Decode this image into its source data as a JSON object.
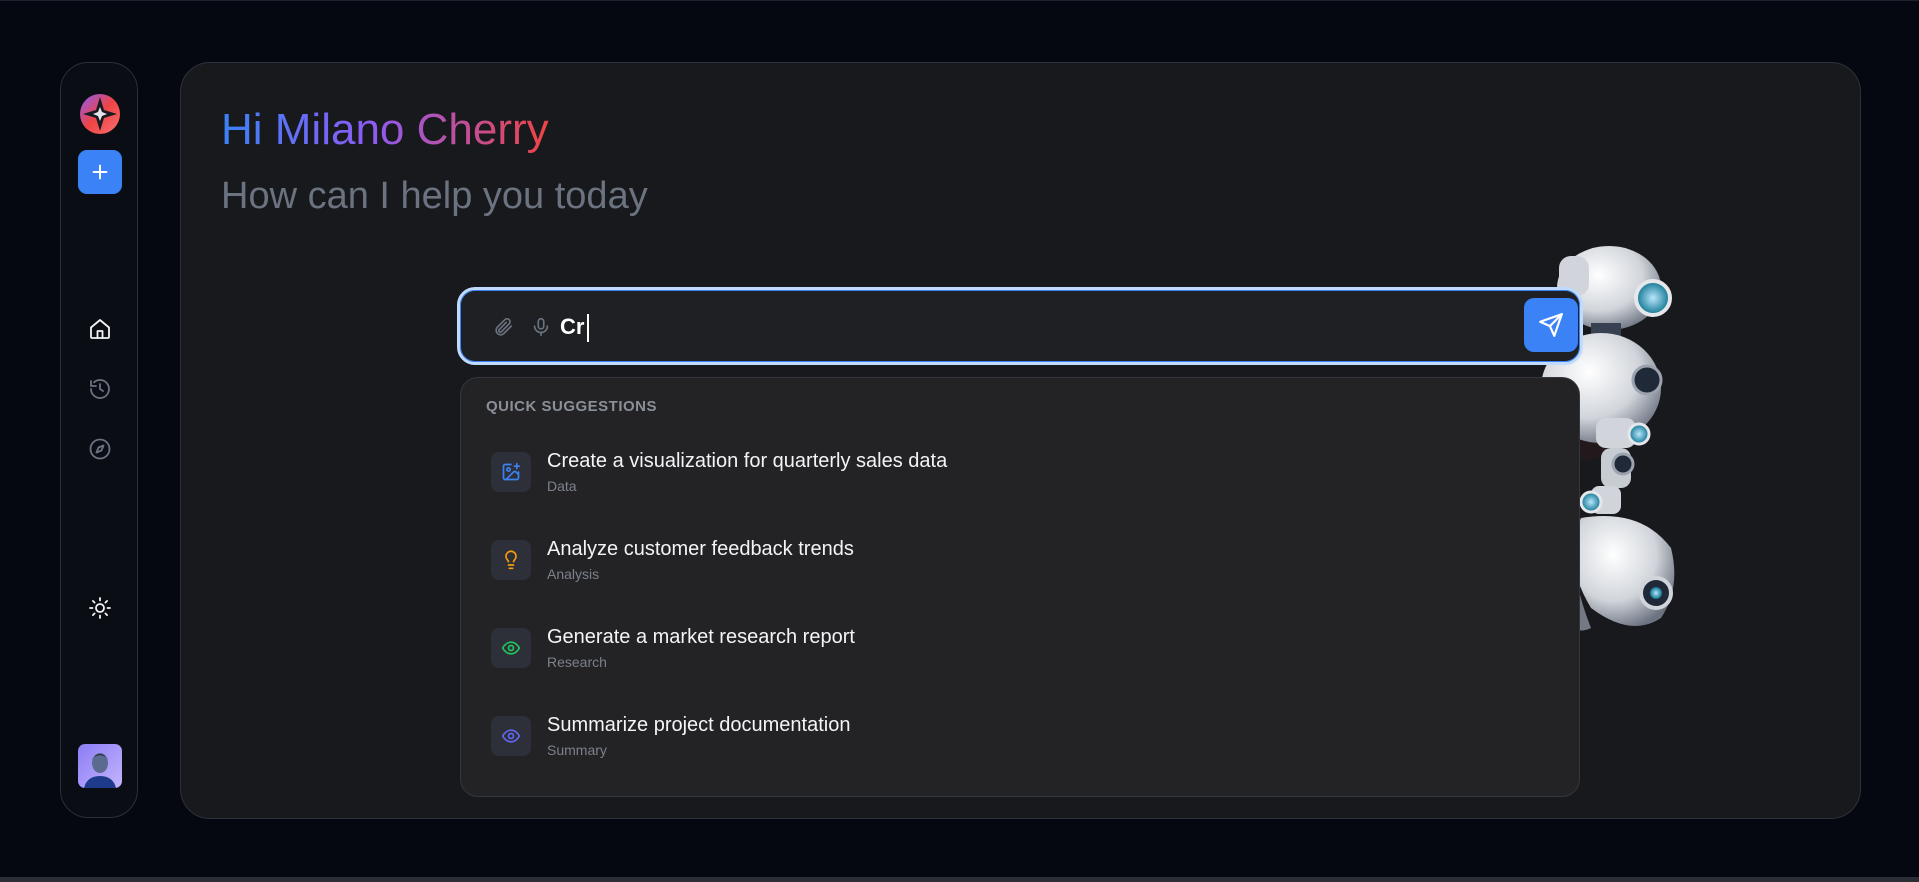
{
  "greeting": "Hi Milano Cherry",
  "subtitle": "How can I help you today",
  "sidebar": {
    "items": [
      {
        "name": "home",
        "icon": "home-icon",
        "active": true
      },
      {
        "name": "history",
        "icon": "history-icon",
        "active": false
      },
      {
        "name": "explore",
        "icon": "compass-icon",
        "active": false
      }
    ],
    "theme_toggle_icon": "sun-icon"
  },
  "input": {
    "value": "Cr",
    "attach_icon": "paperclip-icon",
    "mic_icon": "microphone-icon",
    "send_icon": "send-icon"
  },
  "suggestions": {
    "header": "QUICK SUGGESTIONS",
    "items": [
      {
        "title": "Create a visualization for quarterly sales data",
        "category": "Data",
        "icon": "image-plus-icon",
        "color": "#3b82f6"
      },
      {
        "title": "Analyze customer feedback trends",
        "category": "Analysis",
        "icon": "lightbulb-icon",
        "color": "#f59e0b"
      },
      {
        "title": "Generate a market research report",
        "category": "Research",
        "icon": "eye-icon",
        "color": "#22c55e"
      },
      {
        "title": "Summarize project documentation",
        "category": "Summary",
        "icon": "eye-icon",
        "color": "#6366f1"
      }
    ]
  },
  "colors": {
    "accent": "#3b82f6",
    "background": "#050810",
    "panel": "#18191c"
  }
}
